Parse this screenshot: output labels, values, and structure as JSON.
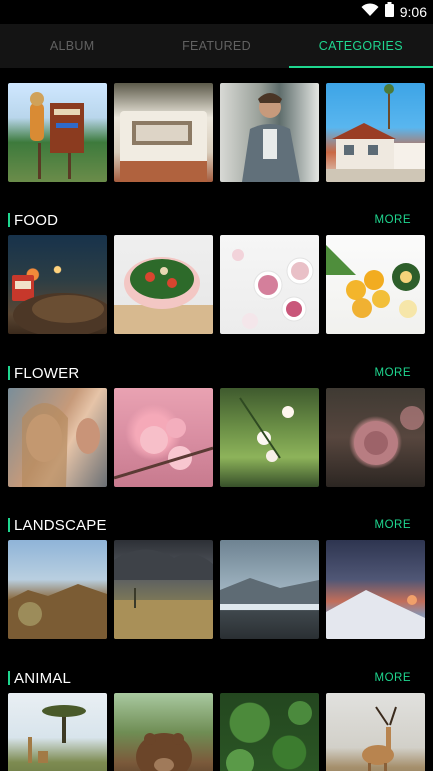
{
  "status": {
    "time": "9:06",
    "wifi_icon": "wifi-icon",
    "battery_icon": "battery-icon"
  },
  "tabs": [
    {
      "label": "ALBUM",
      "active": false
    },
    {
      "label": "FEATURED",
      "active": false
    },
    {
      "label": "CATEGORIES",
      "active": true
    }
  ],
  "top_row": [
    {
      "id": "photo-sign"
    },
    {
      "id": "photo-caravan"
    },
    {
      "id": "photo-man"
    },
    {
      "id": "photo-house"
    }
  ],
  "sections": [
    {
      "title": "FOOD",
      "more": "MORE",
      "items": [
        "photo-market",
        "photo-salad",
        "photo-bowls",
        "photo-lemons"
      ]
    },
    {
      "title": "FLOWER",
      "more": "MORE",
      "items": [
        "photo-women",
        "photo-blossom",
        "photo-white-flowers",
        "photo-dahlia"
      ]
    },
    {
      "title": "LANDSCAPE",
      "more": "MORE",
      "items": [
        "photo-desert",
        "photo-storm",
        "photo-glacier",
        "photo-sunset-snow"
      ]
    },
    {
      "title": "ANIMAL",
      "more": "MORE",
      "items": [
        "photo-giraffes",
        "photo-bear",
        "photo-leaves",
        "photo-antelope"
      ]
    }
  ],
  "colors": {
    "accent": "#1fd68f",
    "background": "#000000",
    "tabbar": "#141414",
    "tab_inactive": "#616161"
  }
}
